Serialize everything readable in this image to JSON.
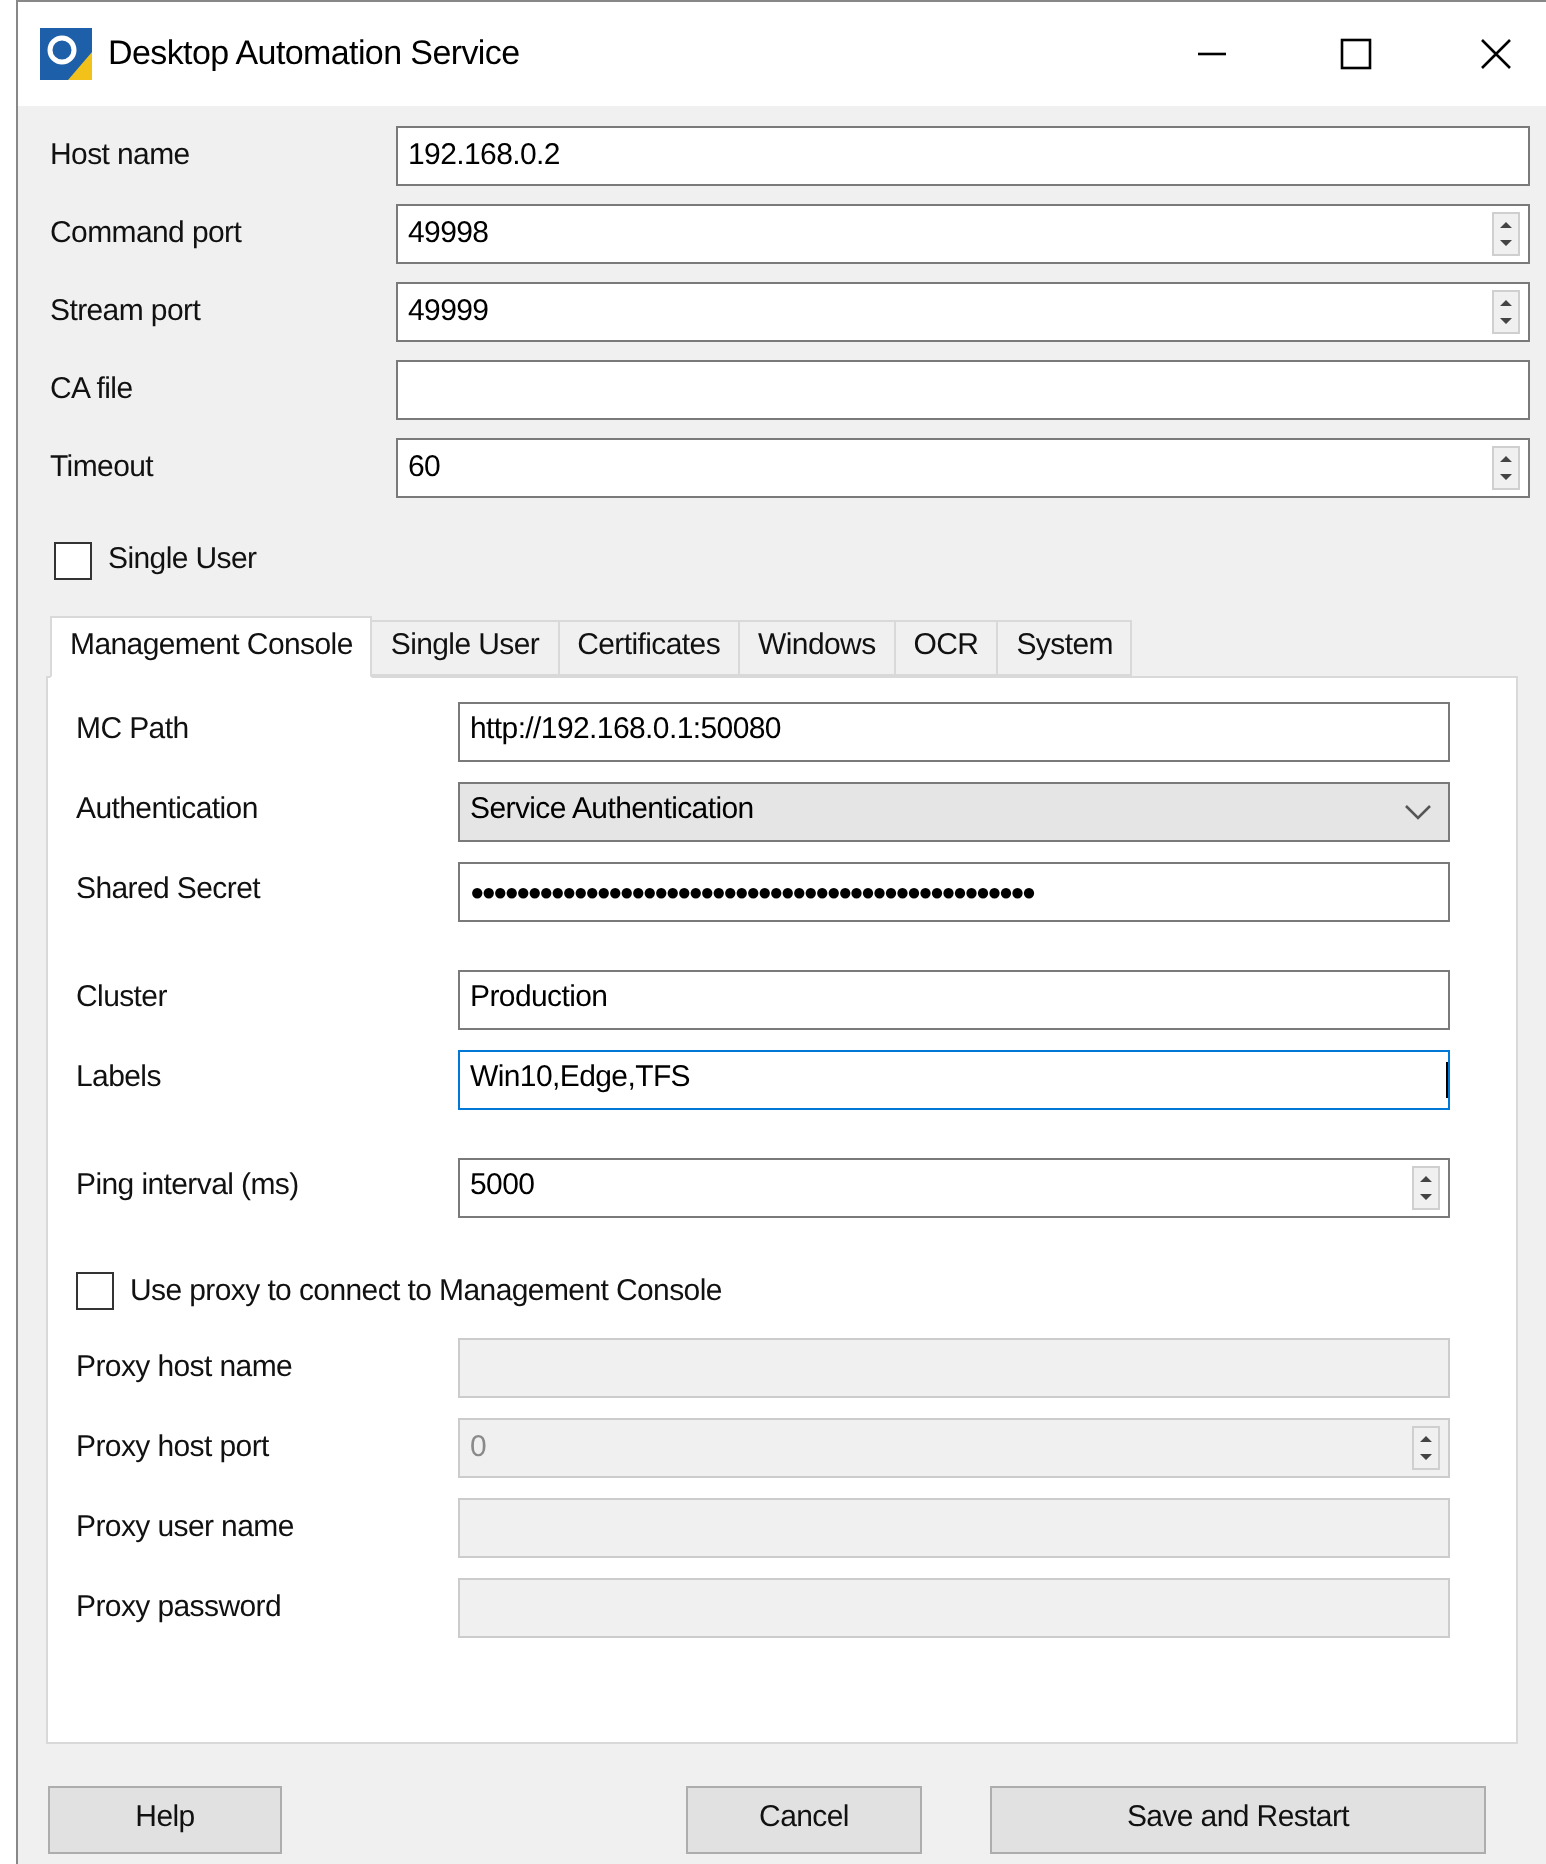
{
  "window": {
    "title": "Desktop Automation Service"
  },
  "fields": [
    {
      "label": "Host name",
      "kind": "text",
      "value": "192.168.0.2"
    },
    {
      "label": "Command port",
      "kind": "spin",
      "value": "49998"
    },
    {
      "label": "Stream port",
      "kind": "spin",
      "value": "49999"
    },
    {
      "label": "CA file",
      "kind": "text"
    },
    {
      "label": "Timeout",
      "kind": "spin",
      "value": "60"
    }
  ],
  "single_user": {
    "label": "Single User",
    "checked": false
  },
  "tabs": [
    {
      "label": "Management Console",
      "selected": true
    },
    {
      "label": "Single User",
      "selected": false
    },
    {
      "label": "Certificates",
      "selected": false
    },
    {
      "label": "Windows",
      "selected": false
    },
    {
      "label": "OCR",
      "selected": false
    },
    {
      "label": "System",
      "selected": false
    }
  ],
  "panel": {
    "groups": [
      [
        {
          "label": "MC Path",
          "kind": "text",
          "value": "http://192.168.0.1:50080",
          "focused": false
        },
        {
          "label": "Authentication",
          "kind": "select",
          "value": "Service Authentication",
          "focused": false
        },
        {
          "label": "Shared Secret",
          "kind": "password",
          "value": "●●●●●●●●●●●●●●●●●●●●●●●●●●●●●●●●●●●●●●●●●●●●●●●●●",
          "focused": false
        }
      ],
      [
        {
          "label": "Cluster",
          "kind": "text",
          "value": "Production",
          "focused": false
        },
        {
          "label": "Labels",
          "kind": "text",
          "value": "Win10,Edge,TFS",
          "focused": true
        }
      ],
      [
        {
          "label": "Ping interval (ms)",
          "kind": "spin",
          "value": "5000",
          "focused": false
        }
      ]
    ],
    "proxy": {
      "label": "Use proxy to connect to Management Console",
      "checked": false
    },
    "proxy_fields": [
      {
        "label": "Proxy host name",
        "kind": "text",
        "disabled": true
      },
      {
        "label": "Proxy host port",
        "kind": "spin",
        "value": "0",
        "disabled": true
      },
      {
        "label": "Proxy user name",
        "kind": "text",
        "disabled": true
      },
      {
        "label": "Proxy password",
        "kind": "text",
        "disabled": true
      }
    ]
  },
  "buttons": [
    {
      "label": "Help"
    },
    {
      "label": "Cancel"
    },
    {
      "label": "Save and Restart"
    }
  ]
}
